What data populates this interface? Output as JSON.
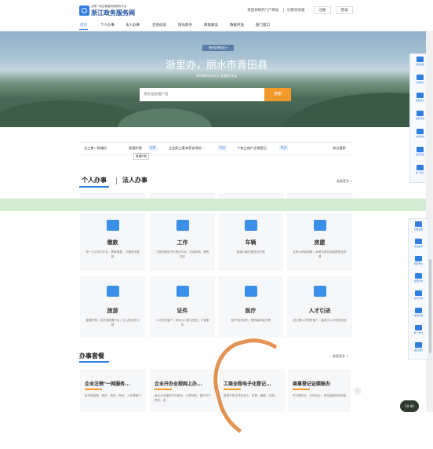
{
  "header": {
    "small_text": "互联一网全覆盖网络服务平台",
    "title": "浙江政务服务网",
    "region": "青田县政府门户网站",
    "switch": "切换到旧版",
    "register": "注册",
    "login": "登录"
  },
  "nav": [
    "首页",
    "个人办事",
    "法人办事",
    "咨询投诉",
    "阳光政务",
    "政策解读",
    "数据开放",
    "部门窗口"
  ],
  "hero": {
    "tag": "青田县青田县 ▾",
    "title": "浙里办，丽水市青田县",
    "date": "2019年9月12日 星期四 多云",
    "search_placeholder": "身份证办理户证",
    "search_button": "搜索"
  },
  "toolbar_top": [
    "智能客服",
    "咨询投诉",
    "我要评价",
    "我要查询",
    "办件查询",
    "常见问题",
    "统一支付"
  ],
  "toolbar_bottom": [
    "智能客服",
    "咨询投诉",
    "我要评价",
    "我要查询",
    "办件查询",
    "常见问题",
    "统一支付",
    "返回顶部"
  ],
  "hot": {
    "label": "长三角一网通办",
    "items": [
      "普通护照",
      "企业职工基本养老保险...",
      "个体工商户注销登记"
    ],
    "tags": [
      "主推",
      "热点",
      "热点"
    ],
    "more": "热点搜索",
    "tooltip": "普通护照"
  },
  "tabs": {
    "personal": "个人办事",
    "legal": "法人办事",
    "more": "查看更多 >"
  },
  "cards": [
    {
      "title": "缴款",
      "desc": "统一公共支付平台：教育缴费、交通违法缴款"
    },
    {
      "title": "工作",
      "desc": "工商全程电子化登记平台：社保查询、职称评定"
    },
    {
      "title": "车辆",
      "desc": "普通公路交通违法处理"
    },
    {
      "title": "房屋",
      "desc": "住房公积金提取；租房住房住房保障登记申请"
    },
    {
      "title": "旅游",
      "desc": "普通护照；往来港澳通行证；出入境证件办理"
    },
    {
      "title": "证件",
      "desc": "人才引进落户；流动人口居住登记；丰富服务"
    },
    {
      "title": "医疗",
      "desc": "医疗预约挂号；预防接种证办理"
    },
    {
      "title": "人才引进",
      "desc": "浙江籍人才购房落户；高层次人才购房补贴"
    }
  ],
  "packages": {
    "title": "办事套餐",
    "more": "查看更多 >",
    "items": [
      {
        "title": "企业注销\"一网服务...",
        "desc": "各市场监督、税务、商务、海关、人社等部门"
      },
      {
        "title": "企业开办全程网上办...",
        "desc": "各企业全程电子化登记、公章刻制、银行开户预约、发..."
      },
      {
        "title": "工商全程电子化登记...",
        "desc": "各类市场主体在设立、变更、备案、注销..."
      },
      {
        "title": "商事登记证照联办",
        "desc": "开办餐饮业、外贸企业，常见经营项目审批"
      }
    ]
  },
  "float_button": "10:40",
  "colors": {
    "accent": "#2f7fe0",
    "search": "#f39a2b",
    "band": "#d3ead3"
  }
}
